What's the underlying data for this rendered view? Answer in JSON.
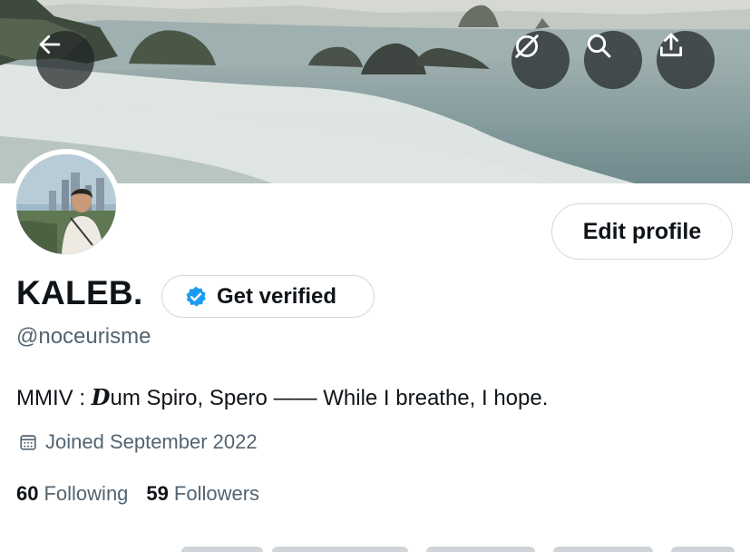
{
  "header": {
    "back_icon": "arrow-left-icon",
    "buttons": [
      {
        "name": "grok-button",
        "icon": "slashed-circle-icon"
      },
      {
        "name": "search-button",
        "icon": "search-icon"
      },
      {
        "name": "share-button",
        "icon": "share-upload-icon"
      }
    ]
  },
  "profile": {
    "display_name": "KALEB.",
    "handle": "@noceurisme",
    "edit_profile_label": "Edit profile",
    "get_verified_label": "Get verified",
    "bio_prefix": "MMIV : ",
    "bio_styled_letter": "D",
    "bio_rest": "um Spiro, Spero —— While I breathe, I hope.",
    "joined": "Joined September 2022",
    "following_count": "60",
    "following_label": "Following",
    "followers_count": "59",
    "followers_label": "Followers"
  },
  "colors": {
    "verified_badge": "#1d9bf0",
    "text_primary": "#0f1419",
    "text_secondary": "#536471",
    "button_border": "#cfd9de"
  }
}
